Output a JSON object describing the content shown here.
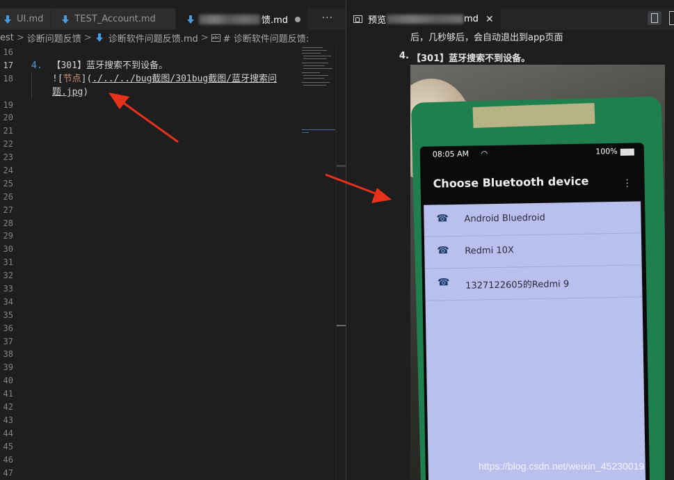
{
  "editor": {
    "tabs": [
      {
        "label": "UI.md"
      },
      {
        "label": "TEST_Account.md"
      },
      {
        "label": "馈.md"
      }
    ],
    "more_label": "···",
    "breadcrumb": {
      "parts": [
        "est",
        "诊断问题反馈",
        "诊断软件问题反馈.md",
        "# 诊断软件问题反馈:"
      ],
      "separator": ">"
    },
    "line_numbers": [
      "16",
      "17",
      "18",
      "19",
      "20",
      "21",
      "22",
      "23",
      "24",
      "25",
      "26",
      "27",
      "28",
      "29",
      "30",
      "31",
      "32",
      "33",
      "34",
      "35",
      "36",
      "37",
      "38",
      "39",
      "40",
      "41",
      "42",
      "43",
      "44",
      "45",
      "46",
      "47"
    ],
    "code": {
      "list_number": "4.",
      "item_text": "【301】蓝牙搜索不到设备。",
      "link_prefix": "![",
      "link_text": "节点",
      "link_mid": "](",
      "link_url_1": "./../../bug截图/301bug截图/蓝牙搜索问",
      "link_url_2": "题.jpg",
      "link_suffix": ")"
    }
  },
  "preview": {
    "tab_prefix": "预览",
    "tab_suffix": "md",
    "close_label": "✕",
    "text_line": "后，几秒够后，会自动退出到app页面",
    "item_number": "4.",
    "item_text": "【301】蓝牙搜索不到设备。",
    "photo": {
      "time": "08:05 AM",
      "battery": "100%",
      "dialog_title": "Choose Bluetooth device",
      "devices": [
        "Android Bluedroid",
        "Redmi 10X",
        "1327122605的Redmi 9"
      ],
      "watermark": "https://blog.csdn.net/weixin_45230019"
    }
  },
  "colors": {
    "editor_bg": "#1e1e1e",
    "arrow": "#e8321e",
    "case_green": "#1f7f4e",
    "list_bg": "#b9c0ee"
  }
}
